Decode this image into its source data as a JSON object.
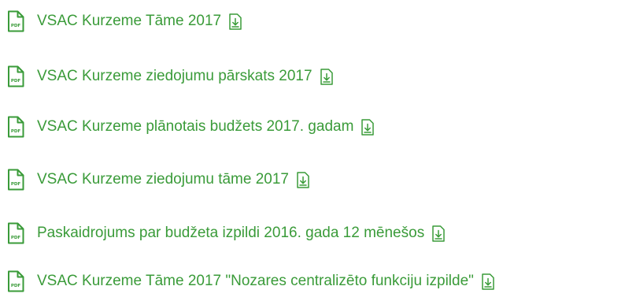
{
  "colors": {
    "link": "#3a9b39",
    "icon": "#3a9b39"
  },
  "icons": {
    "file": "pdf-file-icon",
    "download": "download-icon"
  },
  "pdf_badge": "PDF",
  "documents": [
    {
      "label": "VSAC Kurzeme Tāme 2017"
    },
    {
      "label": "VSAC Kurzeme ziedojumu pārskats 2017"
    },
    {
      "label": "VSAC Kurzeme plānotais budžets 2017. gadam"
    },
    {
      "label": "VSAC Kurzeme ziedojumu tāme 2017"
    },
    {
      "label": "Paskaidrojums par budžeta izpildi 2016. gada 12 mēnešos"
    },
    {
      "label": "VSAC Kurzeme Tāme 2017 \"Nozares centralizēto funkciju izpilde\""
    }
  ]
}
